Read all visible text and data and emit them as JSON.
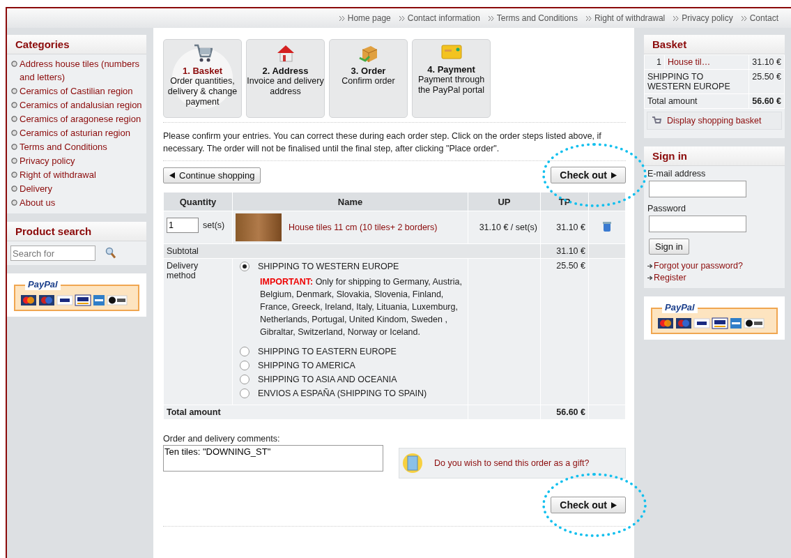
{
  "top_nav": [
    "Home page",
    "Contact information",
    "Terms and Conditions",
    "Right of withdrawal",
    "Privacy policy",
    "Contact"
  ],
  "categories": {
    "title": "Categories",
    "items": [
      "Address house tiles (numbers and letters)",
      "Ceramics of Castilian region",
      "Ceramics of andalusian region",
      "Ceramics of aragonese region",
      "Ceramics of asturian region",
      "Terms and Conditions",
      "Privacy policy",
      "Right of withdrawal",
      "Delivery",
      "About us"
    ]
  },
  "product_search": {
    "title": "Product search",
    "placeholder": "Search for"
  },
  "paypal_badge_left": {
    "logo": "PayPal"
  },
  "steps": [
    {
      "title": "1. Basket",
      "description": "Order quantities, delivery & change payment",
      "selected": true,
      "kind": "cart"
    },
    {
      "title": "2. Address",
      "description": "Invoice and delivery address",
      "selected": false,
      "kind": "house"
    },
    {
      "title": "3. Order",
      "description": "Confirm order",
      "selected": false,
      "kind": "box"
    },
    {
      "title": "4. Payment",
      "description": "Payment through the PayPal portal",
      "selected": false,
      "kind": "card"
    }
  ],
  "intro": "Please confirm your entries. You can correct these during each order step. Click on the order steps listed above, if necessary. The order will not be finalised until the final step, after clicking \"Place order\".",
  "continue_button": "Continue shopping",
  "checkout_button_top": "Check out",
  "table": {
    "columns": [
      "Quantity",
      "Name",
      "UP",
      "TP"
    ],
    "rows": [
      {
        "quantity": "1",
        "unit": "set(s)",
        "name": "House tiles 11 cm (10 tiles+ 2 borders)",
        "up": "31.10 € / set(s)",
        "tp": "31.10 €"
      }
    ],
    "subtotal": {
      "label": "Subtotal",
      "value": "31.10 €"
    },
    "delivery": {
      "label": "Delivery method",
      "price": "25.50 €",
      "options": [
        {
          "label": "SHIPPING TO WESTERN EUROPE",
          "selected": true,
          "note": "**IMPORTANT:** Only for shipping to Germany, Austria, Belgium, Denmark, Slovakia, Slovenia, Finland, France, Greeck, Ireland, Italy, Lituania, Luxemburg, Netherlands, Portugal, United Kindom, Sweden , Gibraltar, Switzerland, Norway or Iceland."
        },
        {
          "label": "SHIPPING TO EASTERN EUROPE",
          "selected": false
        },
        {
          "label": "SHIPPING TO AMERICA",
          "selected": false
        },
        {
          "label": "SHIPPING TO ASIA AND OCEANIA",
          "selected": false
        },
        {
          "label": "ENVIOS A ESPAÑA (SHIPPING TO SPAIN)",
          "selected": false
        }
      ]
    },
    "total": {
      "label": "Total amount",
      "value": "56.60 €"
    }
  },
  "comments": {
    "label": "Order and delivery comments:",
    "value": "Ten tiles: \"DOWNING_ST\""
  },
  "gift_link": "Do you wish to send this order as a gift?",
  "checkout_button_bottom": "Check out",
  "basket": {
    "title": "Basket",
    "items": [
      {
        "quantity": "1",
        "name": "House til…",
        "price": "31.10 €"
      }
    ],
    "shipping": {
      "label": "SHIPPING TO WESTERN EUROPE",
      "price": "25.50 €"
    },
    "total": {
      "label": "Total amount",
      "value": "56.60 €"
    },
    "link": "Display shopping basket"
  },
  "sign_in": {
    "title": "Sign in",
    "email_label": "E-mail address",
    "password_label": "Password",
    "button": "Sign in",
    "links": [
      "Forgot your password?",
      "Register"
    ]
  },
  "paypal_badge_right": {
    "logo": "PayPal"
  }
}
